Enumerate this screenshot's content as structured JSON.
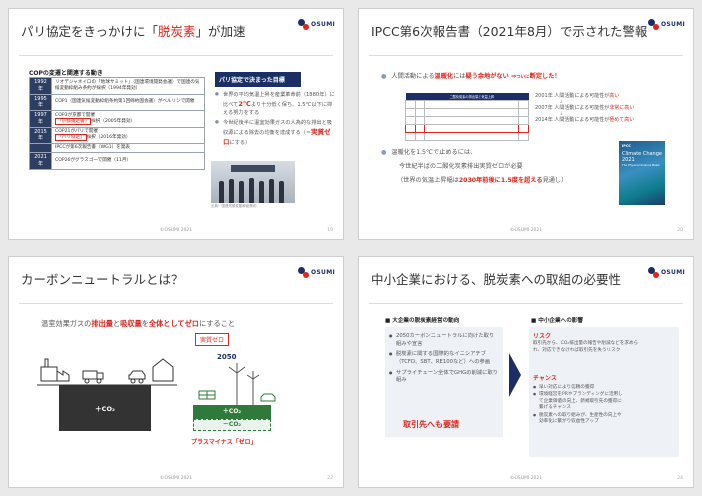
{
  "common": {
    "logo_text": "OSUMI",
    "footer": "©OSUMI 2021"
  },
  "slide1": {
    "title_before": "パリ協定をきっかけに「",
    "title_highlight": "脱炭素",
    "title_after": "」が加速",
    "page": "19",
    "cop_heading": "COPの変遷と関連する動き",
    "cop_rows": [
      {
        "year": "1992年",
        "text": "リオデジャネイロの「地球サミット」（国連環境開発会議）で国連の気候変動枠組み条約が採択（1994年発効）"
      },
      {
        "year": "1995年",
        "text": "COP1（国連気候変動枠組条約第1回締約国会議）がベルリンで開催"
      },
      {
        "year": "1997年",
        "text_before": "COP3が京都で開催 ",
        "text_highlight": "「京都議定書」",
        "text_after": "採択（2005年発効）"
      },
      {
        "year": "2015年",
        "text_before": "COP21がパリで開催 ",
        "text_highlight": "「パリ協定」",
        "text_after": "採択（2016年発効）"
      },
      {
        "year": "",
        "text": "IPCCが第6次報告書（WG1）を発表"
      },
      {
        "year": "2021年",
        "text": "COP26がグラスゴーで開催（11月）"
      }
    ],
    "side_title": "パリ協定で決まった目標",
    "side_points": [
      {
        "before": "世界の平均気温上昇を産業革命前（1880年）に比べて",
        "highlight": "2℃",
        "after": "より十分低く保ち、1.5℃以下に抑える努力をする"
      },
      {
        "before": "今世紀後半に温室効果ガスの人為的な排出と吸収源による除去の均衡を達成する（＝",
        "highlight": "実質ゼロ",
        "after": "にする）"
      }
    ],
    "photo_caption": "出典：国連気候変動枠組条約"
  },
  "slide2": {
    "title": "IPCC第6次報告書（2021年8月）で示された警報",
    "page": "20",
    "point1_before": "人間活動による",
    "point1_red": "温暖化",
    "point1_mid": "には",
    "point1_red2": "疑う余地がない ⇒",
    "point1_small": "ついに",
    "point1_end": "断定した！",
    "table_headers": [
      "",
      "",
      "二酸化炭素の排出量と気温上昇",
      ""
    ],
    "table_rows": [
      [
        "",
        "",
        "",
        ""
      ],
      [
        "",
        "",
        "",
        ""
      ],
      [
        "",
        "",
        "",
        ""
      ],
      [
        "",
        "",
        "",
        ""
      ],
      [
        "",
        "",
        "",
        ""
      ]
    ],
    "timeline": [
      {
        "year": "2001年",
        "text": "人間活動による可能性が",
        "red": "高い"
      },
      {
        "year": "2007年",
        "text": "人間活動による可能性が",
        "red": "非常に高い"
      },
      {
        "year": "2014年",
        "text": "人間活動による可能性が",
        "red": "極めて高い"
      }
    ],
    "point2_line1": "温暖化を1.5℃で止めるには、",
    "point2_line2": "今世紀半ばの二酸化炭素排出実質ゼロが必要",
    "point2_line3_before": "（世界の気温上昇幅は",
    "point2_line3_red": "2030年前後に1.5度を超える",
    "point2_line3_after": "見通し）",
    "report_logo": "IPCC",
    "report_title": "Climate Change 2021",
    "report_sub": "The Physical Science Basis"
  },
  "slide3": {
    "title": "カーボンニュートラルとは？",
    "page": "22",
    "lead_before": "温室効果ガスの",
    "lead_red1": "排出量",
    "lead_mid1": "と",
    "lead_red2": "吸収量",
    "lead_mid2": "を",
    "lead_red3": "全体としてゼロ",
    "lead_after": "にすること",
    "zero_badge": "実質ゼロ",
    "emission_box": "＋CO₂",
    "year_label": "2050",
    "plus_box": "＋CO₂",
    "minus_box": "－CO₂",
    "zero_caption": "プラスマイナス「ゼロ」"
  },
  "slide4": {
    "title": "中小企業における、脱炭素への取組の必要性",
    "page": "24",
    "left_heading": "■ 大企業の脱炭素経営の動向",
    "left_points": [
      "2050カーボンニュートラルに向けた取り組みや宣言",
      "脱炭素に関する国際的なイニシアチブ（TCFD、SBT、RE100など）への参画",
      "サプライチェーン全体でGHGの削減に取り組み"
    ],
    "left_red": "取引先へも要請",
    "right_heading": "■ 中小企業への影響",
    "risk_heading": "リスク",
    "risk_text": "取引先から、CO₂排出量の報告や削減などを求められ、対応できなければ取引先を失うリスク",
    "chance_heading": "チャンス",
    "chance_points": [
      "早い対応により信頼の獲得",
      "環境経営をPRやブランディングに活用して企業価値の向上、新規取引先の獲得に繋げるチャンス",
      "脱炭素への取り組みが、生産性の向上や効率化に繋がり収益性アップ"
    ]
  }
}
